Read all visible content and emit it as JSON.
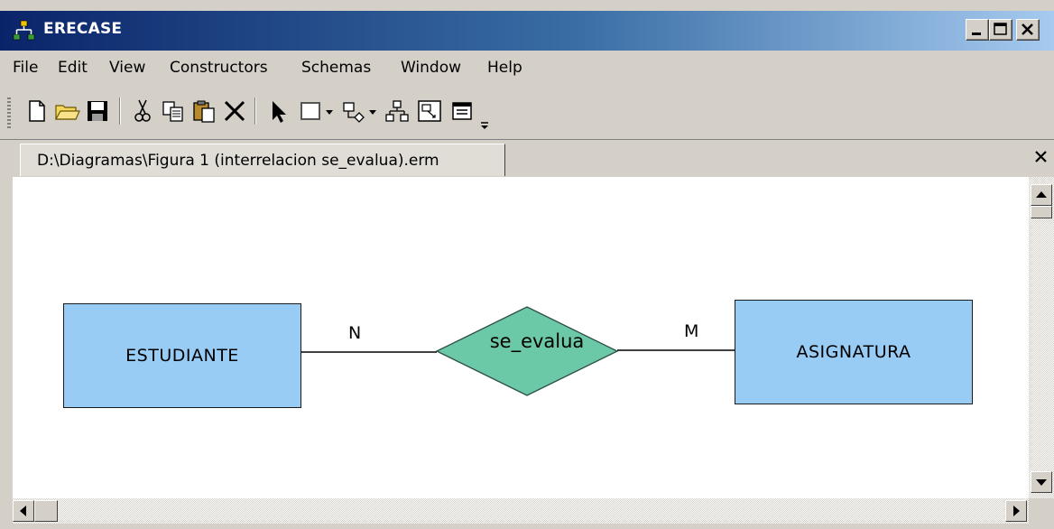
{
  "window": {
    "title": "ERECASE",
    "accent_start": "#0a246a",
    "accent_end": "#a6caf0"
  },
  "menu": [
    "File",
    "Edit",
    "View",
    "Constructors",
    "Schemas",
    "Window",
    "Help"
  ],
  "toolbar": {
    "buttons": [
      "new-icon",
      "open-folder-icon",
      "save-icon",
      "cut-icon",
      "copy-icon",
      "paste-icon",
      "delete-icon",
      "select-arrow-icon",
      "entity-rectangle-icon",
      "relationship-icon",
      "hierarchy-icon",
      "attribute-icon",
      "properties-icon"
    ]
  },
  "tab": {
    "label": "D:\\Diagramas\\Figura 1 (interrelacion se_evalua).erm"
  },
  "diagram": {
    "entity_left": "ESTUDIANTE",
    "entity_right": "ASIGNATURA",
    "relationship": "se_evalua",
    "cardinality_left": "N",
    "cardinality_right": "M",
    "entity_color": "#99ccf5",
    "relationship_color": "#6cc9a8"
  }
}
